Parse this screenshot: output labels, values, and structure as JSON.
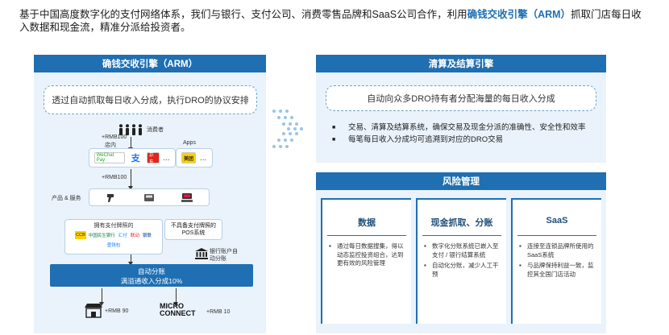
{
  "intro": {
    "part1": "基于中国高度数字化的支付网络体系，我们与银行、支付公司、消费零售品牌和SaaS公司合作，利用",
    "highlight": "确钱交收引擎（ARM）",
    "part2": "抓取门店每日收入数据和现金流，精准分派给投资者。"
  },
  "left": {
    "title": "确钱交收引擎（ARM）",
    "desc": "透过自动抓取每日收入分成，执行DRO的协议安排",
    "consumers": "消费者",
    "rmb100_top": "+RMB100",
    "instore": "店内",
    "apps": "Apps",
    "wechat": "WeChat Pay",
    "zhi": "支",
    "jd": "京东",
    "meituan": "美团",
    "dots": "…",
    "rmb100_mid": "+RMB100",
    "products": "产品 & 服务",
    "with_license": "拥有支付牌照的",
    "without_license": "不具备支付牌照的POS系统",
    "bank_auto": "银行账户自动分账",
    "settle_line1": "自动分账",
    "settle_line2": "满溢通收入分成10%",
    "rmb90": "+RMB 90",
    "mc_line1": "MICRO",
    "mc_line2": "CONNECT",
    "rmb10": "+RMB 10",
    "banks": [
      "CCB",
      "中国民生银行",
      "汇付",
      "联动",
      "银联",
      "壹钱包"
    ]
  },
  "right_top": {
    "title": "清算及结算引擎",
    "desc": "自动向众多DRO持有者分配海量的每日收入分成",
    "bullets": [
      "交易、清算及结算系统，确保交易及现金分派的准确性、安全性和效率",
      "每笔每日收入分成均可追溯到对应的DRO交易"
    ]
  },
  "right_bottom": {
    "title": "风险管理",
    "cards": [
      {
        "title": "数据",
        "items": [
          "通过每日数据搜集，得以动态监控投资组合，达到更有效的风险管理"
        ]
      },
      {
        "title": "现金抓取、分账",
        "items": [
          "数字化分账系统已嵌入至支付 / 银行结算系统",
          "自动化分账，减少人工干预"
        ]
      },
      {
        "title": "SaaS",
        "items": [
          "连接至连锁品牌所使用的SaaS系统",
          "与品牌保持利益一致，监控其全国门店活动"
        ]
      }
    ]
  },
  "colors": {
    "primary": "#1f6fb2",
    "panel_bg": "#eaf3fb",
    "highlight": "#1f6fb2"
  }
}
